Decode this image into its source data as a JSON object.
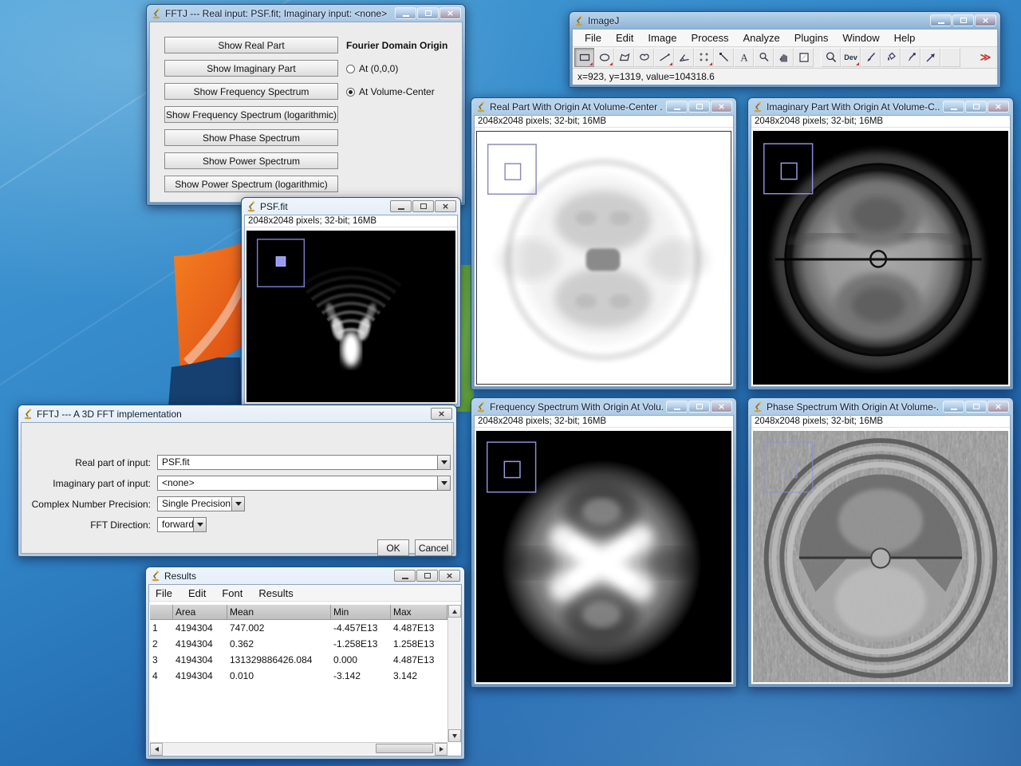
{
  "fftj_panel": {
    "title": "FFTJ --- Real input: PSF.fit; Imaginary input: <none>",
    "buttons": [
      "Show Real Part",
      "Show Imaginary Part",
      "Show Frequency Spectrum",
      "Show Frequency Spectrum (logarithmic)",
      "Show Phase Spectrum",
      "Show Power Spectrum",
      "Show Power Spectrum (logarithmic)"
    ],
    "origin_heading": "Fourier Domain Origin",
    "radio_origin_000": "At (0,0,0)",
    "radio_origin_center": "At Volume-Center",
    "selected_origin": "At Volume-Center"
  },
  "imagej": {
    "title": "ImageJ",
    "menus": [
      "File",
      "Edit",
      "Image",
      "Process",
      "Analyze",
      "Plugins",
      "Window",
      "Help"
    ],
    "text_tool_label": "A",
    "dev_tool_label": "Dev",
    "more_tools_label": "≫",
    "status": "x=923, y=1319, value=104318.6"
  },
  "image_windows": {
    "real": {
      "title": "Real Part With Origin At Volume-Center ...",
      "info": "2048x2048 pixels; 32-bit; 16MB"
    },
    "imaginary": {
      "title": "Imaginary Part With Origin At Volume-C...",
      "info": "2048x2048 pixels; 32-bit; 16MB"
    },
    "psf": {
      "title": "PSF.fit",
      "info": "2048x2048 pixels; 32-bit; 16MB"
    },
    "frequency": {
      "title": "Frequency Spectrum With Origin At Volu...",
      "info": "2048x2048 pixels; 32-bit; 16MB"
    },
    "phase": {
      "title": "Phase Spectrum With Origin At Volume-...",
      "info": "2048x2048 pixels; 32-bit; 16MB"
    }
  },
  "fftj_dialog": {
    "title": "FFTJ --- A 3D FFT implementation",
    "real_label": "Real part of input:",
    "real_value": "PSF.fit",
    "imag_label": "Imaginary part of input:",
    "imag_value": "<none>",
    "precision_label": "Complex Number Precision:",
    "precision_value": "Single Precision",
    "direction_label": "FFT Direction:",
    "direction_value": "forward",
    "ok": "OK",
    "cancel": "Cancel"
  },
  "results": {
    "title": "Results",
    "menus": [
      "File",
      "Edit",
      "Font",
      "Results"
    ],
    "columns": {
      "c0": "",
      "area": "Area",
      "mean": "Mean",
      "min": "Min",
      "max": "Max"
    },
    "rows": [
      {
        "n": "1",
        "area": "4194304",
        "mean": "747.002",
        "min": "-4.457E13",
        "max": "4.487E13"
      },
      {
        "n": "2",
        "area": "4194304",
        "mean": "0.362",
        "min": "-1.258E13",
        "max": "1.258E13"
      },
      {
        "n": "3",
        "area": "4194304",
        "mean": "131329886426.084",
        "min": "0.000",
        "max": "4.487E13"
      },
      {
        "n": "4",
        "area": "4194304",
        "mean": "0.010",
        "min": "-3.142",
        "max": "3.142"
      }
    ]
  }
}
